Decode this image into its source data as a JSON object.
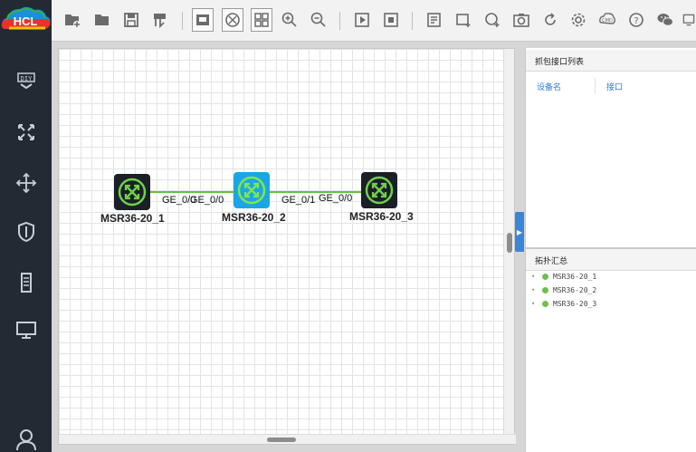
{
  "app": {
    "logo_text": "HCL"
  },
  "sidebar": {
    "items": [
      {
        "name": "diy",
        "icon": "diy-icon"
      },
      {
        "name": "router",
        "icon": "router-icon"
      },
      {
        "name": "switch",
        "icon": "switch-icon"
      },
      {
        "name": "security",
        "icon": "shield-icon"
      },
      {
        "name": "server",
        "icon": "server-icon"
      },
      {
        "name": "terminal",
        "icon": "monitor-icon"
      },
      {
        "name": "user",
        "icon": "user-icon"
      }
    ]
  },
  "toolbar": {
    "buttons": [
      "new-project-icon",
      "open-folder-icon",
      "save-icon",
      "save-as-icon",
      "show-interface-icon",
      "hide-grid-icon",
      "grid-icon",
      "zoom-in-icon",
      "zoom-out-icon",
      "start-all-icon",
      "stop-all-icon",
      "notes-icon",
      "add-rect-icon",
      "add-ellipse-icon",
      "screenshot-icon",
      "refresh-icon",
      "settings-icon",
      "cmd-icon",
      "help-icon",
      "wechat-icon",
      "more-icon"
    ]
  },
  "topology": {
    "devices": [
      {
        "name": "MSR36-20_1",
        "style": "dark"
      },
      {
        "name": "MSR36-20_2",
        "style": "blue"
      },
      {
        "name": "MSR36-20_3",
        "style": "dark"
      }
    ],
    "links": [
      {
        "from_port": "GE_0/0",
        "to_port": "GE_0/0"
      },
      {
        "from_port": "GE_0/1",
        "to_port": "GE_0/0"
      }
    ]
  },
  "capture_panel": {
    "title": "抓包接口列表",
    "columns": [
      "设备名",
      "接口"
    ]
  },
  "topology_summary": {
    "title": "拓扑汇总",
    "items": [
      "MSR36-20_1",
      "MSR36-20_2",
      "MSR36-20_3"
    ]
  },
  "colors": {
    "sidebar_bg": "#232a33",
    "link_green": "#62c23f",
    "device_blue": "#1aa6e6",
    "status_green": "#6cc14a"
  }
}
